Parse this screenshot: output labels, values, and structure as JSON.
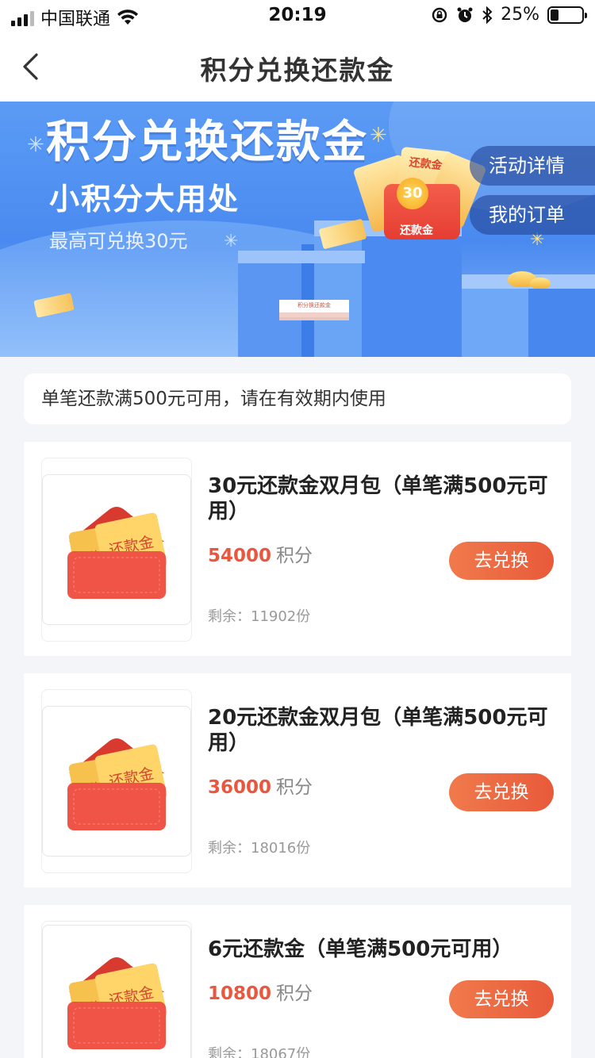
{
  "status_bar": {
    "carrier": "中国联通",
    "time": "20:19",
    "battery": "25%",
    "battery_level": 0.25
  },
  "nav": {
    "title": "积分兑换还款金",
    "back_icon": "chevron-left-icon"
  },
  "banner": {
    "title": "积分兑换还款金",
    "subtitle": "小积分大用处",
    "subtitle2": "最高可兑换30元",
    "detail_button": "活动详情",
    "orders_button": "我的订单",
    "badge_amount": "30",
    "badge_label": "还款金",
    "ticket_text": "还款金",
    "stack_text": "积分换还款金",
    "colors": {
      "gradient_top": "#5b9bf5",
      "gradient_bottom": "#8bb8f7"
    }
  },
  "notice": "单笔还款满500元可用，请在有效期内使用",
  "items": [
    {
      "name": "30元还款金双月包（单笔满500元可用）",
      "points_value": "54000",
      "points_unit": "积分",
      "remaining": "剩余：11902份",
      "button": "去兑换",
      "ticket_label": "还款金",
      "ticket_label_back": "还款"
    },
    {
      "name": "20元还款金双月包（单笔满500元可用）",
      "points_value": "36000",
      "points_unit": "积分",
      "remaining": "剩余：18016份",
      "button": "去兑换",
      "ticket_label": "还款金",
      "ticket_label_back": "还款"
    },
    {
      "name": "6元还款金（单笔满500元可用）",
      "points_value": "10800",
      "points_unit": "积分",
      "remaining": "剩余：18067份",
      "button": "去兑换",
      "ticket_label": "还款金",
      "ticket_label_back": "还款"
    }
  ],
  "colors": {
    "accent": "#e9573f",
    "button_gradient_start": "#f07a4c",
    "button_gradient_end": "#e85a3a",
    "page_bg": "#f4f5f8"
  }
}
